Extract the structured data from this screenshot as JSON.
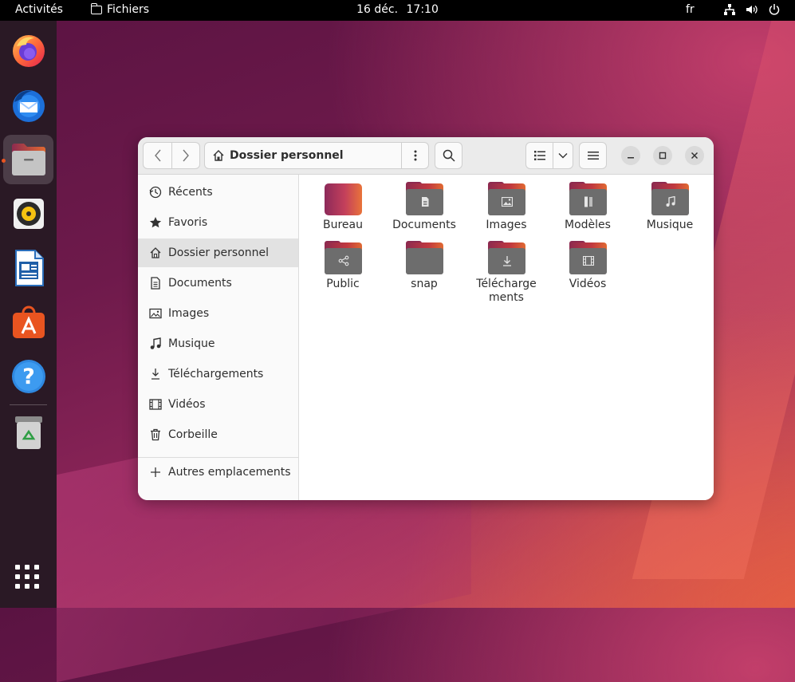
{
  "topbar": {
    "activities": "Activités",
    "app_name": "Fichiers",
    "date": "16 déc.",
    "time": "17:10",
    "lang": "fr",
    "tray_icons": [
      "network-icon",
      "volume-icon",
      "power-icon"
    ]
  },
  "dock": {
    "items": [
      {
        "name": "firefox",
        "icon": "firefox-icon"
      },
      {
        "name": "thunderbird",
        "icon": "thunderbird-icon"
      },
      {
        "name": "files",
        "icon": "files-icon",
        "active": true
      },
      {
        "name": "rhythmbox",
        "icon": "rhythmbox-icon"
      },
      {
        "name": "libreoffice-writer",
        "icon": "writer-icon"
      },
      {
        "name": "app-center",
        "icon": "app-center-icon"
      },
      {
        "name": "help",
        "icon": "help-icon"
      },
      {
        "name": "trash",
        "icon": "trash-icon"
      }
    ],
    "show_apps_icon": "app-grid-icon"
  },
  "window": {
    "location": "Dossier personnel",
    "sidebar": {
      "items": [
        {
          "label": "Récents",
          "icon": "recent-icon"
        },
        {
          "label": "Favoris",
          "icon": "star-icon"
        },
        {
          "label": "Dossier personnel",
          "icon": "home-icon",
          "selected": true
        },
        {
          "label": "Documents",
          "icon": "document-icon"
        },
        {
          "label": "Images",
          "icon": "image-icon"
        },
        {
          "label": "Musique",
          "icon": "music-icon"
        },
        {
          "label": "Téléchargements",
          "icon": "download-icon"
        },
        {
          "label": "Vidéos",
          "icon": "video-icon"
        },
        {
          "label": "Corbeille",
          "icon": "trash-icon"
        }
      ],
      "other": {
        "label": "Autres emplacements",
        "icon": "plus-icon"
      }
    },
    "files": [
      {
        "name": "Bureau",
        "type": "desktop"
      },
      {
        "name": "Documents",
        "type": "documents"
      },
      {
        "name": "Images",
        "type": "pictures"
      },
      {
        "name": "Modèles",
        "type": "templates"
      },
      {
        "name": "Musique",
        "type": "music"
      },
      {
        "name": "Public",
        "type": "public"
      },
      {
        "name": "snap",
        "type": "plain"
      },
      {
        "name": "Télécharge\nments",
        "type": "downloads"
      },
      {
        "name": "Vidéos",
        "type": "videos"
      }
    ]
  },
  "colors": {
    "accent": "#e95420",
    "folder_front": "#6d6d6d",
    "topbar": "#000000",
    "dock": "#2a1925"
  }
}
